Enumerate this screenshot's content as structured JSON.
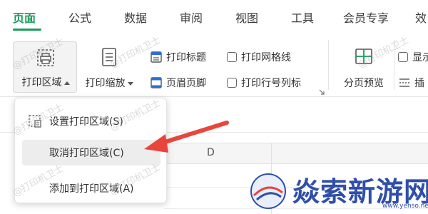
{
  "tabs": [
    {
      "label": "页面",
      "active": true
    },
    {
      "label": "公式"
    },
    {
      "label": "数据"
    },
    {
      "label": "审阅"
    },
    {
      "label": "视图"
    },
    {
      "label": "工具"
    },
    {
      "label": "会员专享"
    },
    {
      "label": "效"
    }
  ],
  "ribbon": {
    "print_area": {
      "label": "打印区域",
      "icon": "print-area-icon"
    },
    "print_scale": {
      "label": "打印缩放",
      "icon": "print-scale-icon"
    },
    "print_title": {
      "label": "打印标题",
      "icon": "print-title-icon"
    },
    "header_footer": {
      "label": "页眉页脚",
      "icon": "header-footer-icon"
    },
    "print_gridlines": {
      "label": "打印网格线",
      "checked": false
    },
    "print_row_col_headers": {
      "label": "打印行号列标",
      "checked": false
    },
    "page_break_preview": {
      "label": "分页预览",
      "icon": "page-break-preview-icon"
    },
    "show_partial": {
      "label": "显示",
      "checked": false
    },
    "insert_partial": {
      "label": "插"
    }
  },
  "menu": {
    "items": [
      {
        "label": "设置打印区域(S)",
        "icon": "set-print-area-icon"
      },
      {
        "label": "取消打印区域(C)",
        "hover": true
      },
      {
        "label": "添加到打印区域(A)"
      }
    ]
  },
  "sheet": {
    "column_header": "D"
  },
  "watermark": "@打印机卫士",
  "logo": {
    "text": "焱索新游网",
    "url": "www.yenso.net"
  },
  "colors": {
    "accent": "#1a9a5a",
    "arrow": "#e8453c",
    "logo": "#2f4fa8"
  }
}
